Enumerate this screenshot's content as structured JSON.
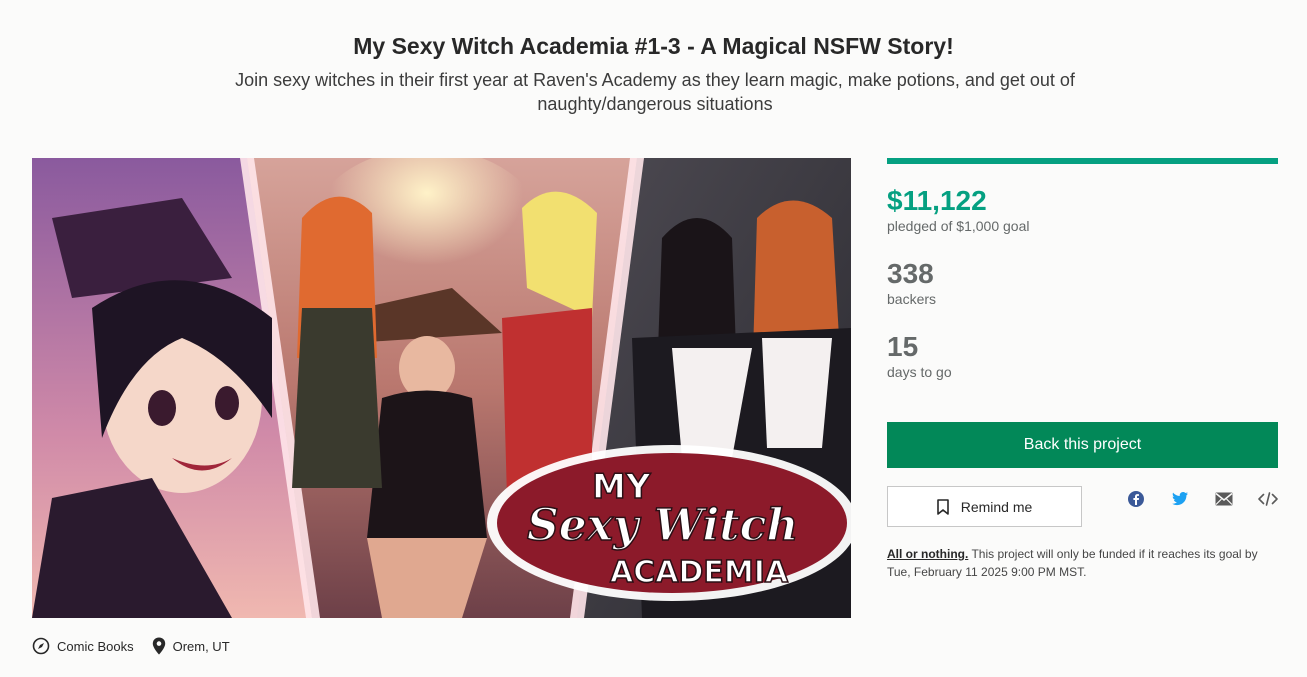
{
  "project": {
    "title": "My Sexy Witch Academia #1-3 - A Magical NSFW Story!",
    "blurb": "Join sexy witches in their first year at Raven's Academy as they learn magic, make potions, and get out of naughty/dangerous situations"
  },
  "media": {
    "logo_line1": "MY",
    "logo_line2": "Sexy Witch",
    "logo_line3": "ACADEMIA"
  },
  "meta": {
    "category": "Comic Books",
    "category_icon": "compass-icon",
    "location": "Orem, UT",
    "location_icon": "map-pin-icon"
  },
  "stats": {
    "progress_fraction": 1.0,
    "pledged": "$11,122",
    "pledged_label": "pledged of $1,000 goal",
    "backers": "338",
    "backers_label": "backers",
    "days": "15",
    "days_label": "days to go"
  },
  "actions": {
    "back_label": "Back this project",
    "remind_label": "Remind me",
    "share_icons": [
      "facebook-icon",
      "twitter-icon",
      "email-icon",
      "embed-icon"
    ]
  },
  "fine_print": {
    "link": "All or nothing.",
    "text": " This project will only be funded if it reaches its goal by Tue, February 11 2025 9:00 PM MST."
  },
  "colors": {
    "accent": "#05a081",
    "button": "#028858",
    "background": "#fbfbfa"
  }
}
